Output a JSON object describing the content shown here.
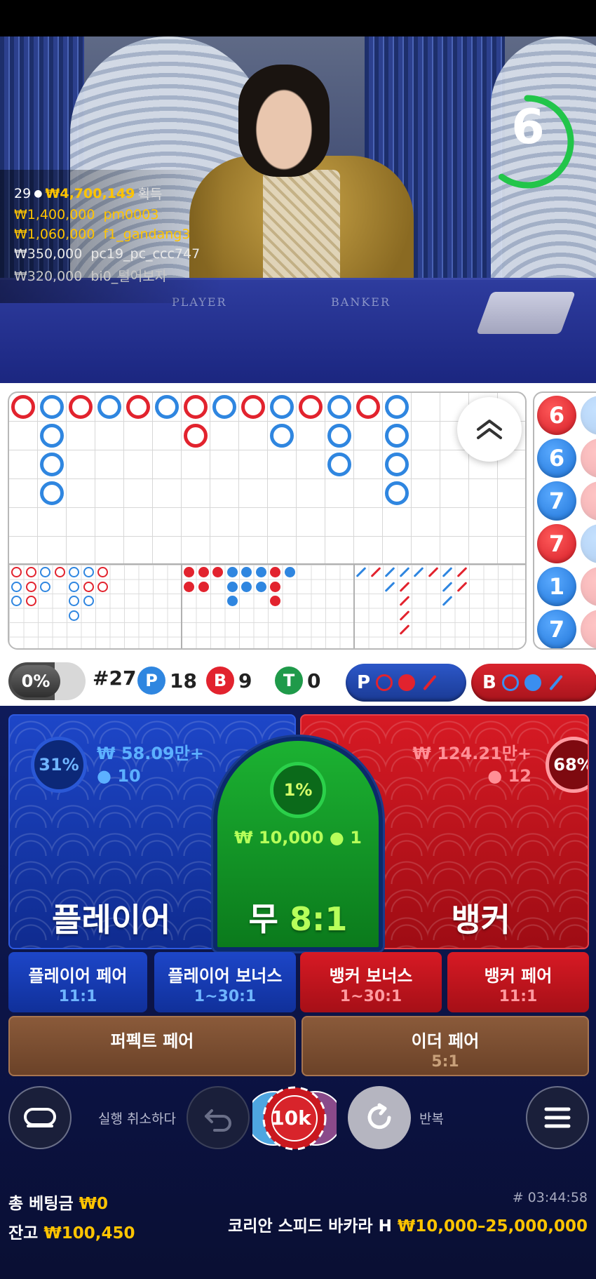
{
  "video": {
    "table_labels": {
      "player": "PLAYER",
      "banker": "BANKER"
    },
    "countdown": "6",
    "countdown_progress": 0.6,
    "winners": {
      "count": "29",
      "total": "₩4,700,149",
      "label": "획득",
      "rows": [
        {
          "amount": "₩1,400,000",
          "user": "pm0003",
          "color": "#ffc400"
        },
        {
          "amount": "₩1,060,000",
          "user": "f1_gandang3",
          "color": "#ffc400"
        },
        {
          "amount": "₩350,000",
          "user": "pc19_pc_ccc747",
          "color": "#e8e8e8"
        },
        {
          "amount": "₩320,000",
          "user": "bi0_털어보자",
          "color": "#c8c8c8"
        }
      ]
    }
  },
  "roadmap": {
    "big_road": [
      [
        "B"
      ],
      [
        "P",
        "P",
        "P",
        "P"
      ],
      [
        "B"
      ],
      [
        "P"
      ],
      [
        "B"
      ],
      [
        "P"
      ],
      [
        "B",
        "B"
      ],
      [
        "P"
      ],
      [
        "B"
      ],
      [
        "P",
        "P"
      ],
      [
        "B"
      ],
      [
        "P",
        "P",
        "P"
      ],
      [
        "B"
      ],
      [
        "P",
        "P",
        "P",
        "P"
      ]
    ],
    "bead_column": [
      {
        "value": "6",
        "color": "red"
      },
      {
        "value": "6",
        "color": "blue"
      },
      {
        "value": "7",
        "color": "blue"
      },
      {
        "value": "7",
        "color": "red"
      },
      {
        "value": "1",
        "color": "blue"
      },
      {
        "value": "7",
        "color": "blue"
      }
    ],
    "stats": {
      "percent": "0%",
      "round": "#27",
      "player_label": "P",
      "player_count": "18",
      "banker_label": "B",
      "banker_count": "9",
      "tie_label": "T",
      "tie_count": "0"
    },
    "predict": {
      "player_label": "P",
      "banker_label": "B"
    }
  },
  "betting": {
    "player": {
      "title": "플레이어",
      "percent": "31%",
      "amount": "₩ 58.09만+",
      "players": "10"
    },
    "tie": {
      "title": "무",
      "odds": "8:1",
      "percent": "1%",
      "amount": "₩ 10,000",
      "players": "1"
    },
    "banker": {
      "title": "뱅커",
      "percent": "68%",
      "amount": "₩ 124.21만+",
      "players": "12"
    },
    "sides": [
      {
        "title": "플레이어 페어",
        "odds": "11:1"
      },
      {
        "title": "플레이어 보너스",
        "odds": "1~30:1"
      },
      {
        "title": "뱅커 보너스",
        "odds": "1~30:1"
      },
      {
        "title": "뱅커 페어",
        "odds": "11:1"
      }
    ],
    "perfect_pair": {
      "title": "퍼펙트 페어"
    },
    "either_pair": {
      "title": "이더 페어",
      "odds": "5:1"
    }
  },
  "controls": {
    "undo_label": "실행 취소하다",
    "chip_value": "10k",
    "repeat_label": "반복"
  },
  "footer": {
    "total_bet_label": "총 베팅금",
    "total_bet": "₩0",
    "balance_label": "잔고",
    "balance": "₩100,450",
    "round_id": "# 03:44:58",
    "table_name": "코리안 스피드 바카라 H",
    "limits": "₩10,000–25,000,000"
  },
  "colors": {
    "banker": "#e2232e",
    "player": "#2f86e0",
    "tie": "#1f9a4a",
    "gold": "#ffc400"
  }
}
